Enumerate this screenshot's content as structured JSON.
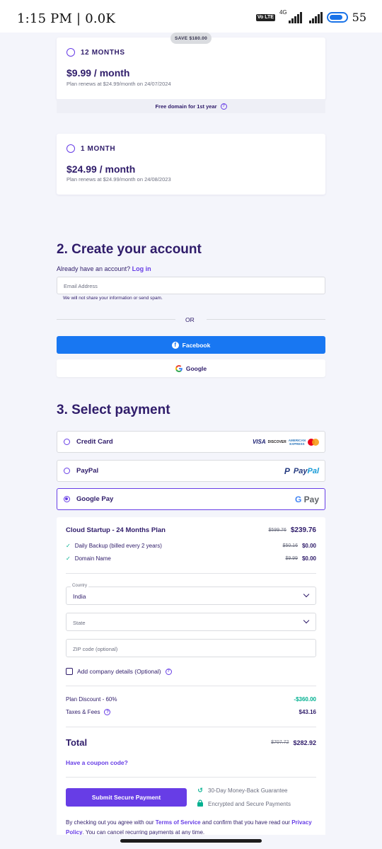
{
  "status_bar": {
    "time": "1:15 PM | 0.0K",
    "volte": "Vo LTE",
    "network": "4G",
    "battery": "55"
  },
  "plans": {
    "save_badge": "SAVE $180.00",
    "plan_12": {
      "label": "12 MONTHS",
      "price": "$9.99 / month",
      "renew": "Plan renews at $24.99/month on 24/07/2024",
      "free_domain": "Free domain for 1st year"
    },
    "plan_1": {
      "label": "1 MONTH",
      "price": "$24.99 / month",
      "renew": "Plan renews at $24.99/month on 24/08/2023"
    }
  },
  "account": {
    "title": "2. Create your account",
    "already": "Already have an account?",
    "login": "Log in",
    "email_placeholder": "Email Address",
    "privacy_note": "We will not share your information or send spam.",
    "or": "OR",
    "facebook": "Facebook",
    "google": "Google"
  },
  "payment": {
    "title": "3. Select payment",
    "options": [
      {
        "label": "Credit Card"
      },
      {
        "label": "PayPal"
      },
      {
        "label": "Google Pay"
      }
    ],
    "logos": {
      "visa": "VISA",
      "discover": "DISCOVER",
      "amex_1": "AMERICAN",
      "amex_2": "EXPRESS",
      "paypal_a": "Pay",
      "paypal_b": "Pal",
      "gpay_g": "G",
      "gpay_pay": "Pay"
    }
  },
  "summary": {
    "plan_name": "Cloud Startup - 24 Months Plan",
    "plan_old": "$599.76",
    "plan_new": "$239.76",
    "items": [
      {
        "label": "Daily Backup (billed every 2 years)",
        "old": "$50.16",
        "new": "$0.00"
      },
      {
        "label": "Domain Name",
        "old": "$9.99",
        "new": "$0.00"
      }
    ],
    "country_label": "Country",
    "country_value": "India",
    "state_placeholder": "State",
    "zip_placeholder": "ZIP code (optional)",
    "company_details": "Add company details (Optional)",
    "discount_label": "Plan Discount - 60%",
    "discount_value": "-$360.00",
    "taxes_label": "Taxes & Fees",
    "taxes_value": "$43.16",
    "total_label": "Total",
    "total_old": "$707.72",
    "total_new": "$282.92",
    "coupon": "Have a coupon code?",
    "submit": "Submit Secure Payment",
    "guarantee": "30-Day Money-Back Guarantee",
    "secure": "Encrypted and Secure Payments",
    "terms_1": "By checking out you agree with our",
    "terms_link": "Terms of Service",
    "terms_2": "and confirm that you have read our",
    "privacy_link": "Privacy Policy",
    "terms_3": ". You can cancel recurring payments at any time."
  },
  "colors": {
    "primary": "#673de6",
    "text": "#2f1c6a",
    "facebook": "#1877f2",
    "success": "#00b090",
    "background": "#f4f5fb"
  }
}
